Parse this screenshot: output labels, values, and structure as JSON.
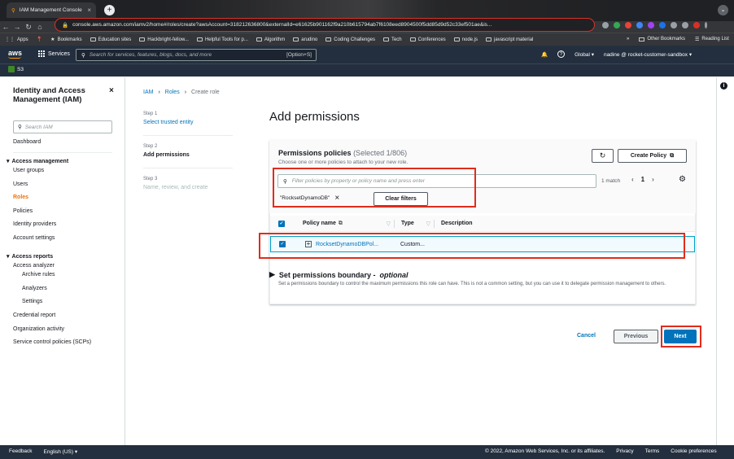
{
  "browser": {
    "tab_title": "IAM Management Console",
    "url": "console.aws.amazon.com/iamv2/home#/roles/create?awsAccount=318212636800&externalId=e61625b901162f9a210b615794ab7f6108eed8904500f5dd85d9d52c33ef501ae&is...",
    "bookmarks": [
      "Apps",
      "Bookmarks",
      "Education sites",
      "Hackbright-fellow...",
      "Helpful Tools for p...",
      "Algorithm",
      "arudino",
      "Coding Challenges",
      "Tech",
      "Conferences",
      "node.js",
      "javascript material"
    ],
    "other_bookmarks": "Other Bookmarks",
    "reading_list": "Reading List"
  },
  "aws_nav": {
    "logo": "aws",
    "services_label": "Services",
    "search_placeholder": "Search for services, features, blogs, docs, and more",
    "search_shortcut": "[Option+S]",
    "region": "Global ▾",
    "account": "nadine @ rocket-customer-sandbox ▾",
    "favorite": "S3"
  },
  "sidebar": {
    "title": "Identity and Access Management (IAM)",
    "search_placeholder": "Search IAM",
    "dashboard": "Dashboard",
    "access_management": "Access management",
    "am_items": [
      "User groups",
      "Users",
      "Roles",
      "Policies",
      "Identity providers",
      "Account settings"
    ],
    "access_reports": "Access reports",
    "ar_items": [
      "Access analyzer",
      "Archive rules",
      "Analyzers",
      "Settings",
      "Credential report",
      "Organization activity",
      "Service control policies (SCPs)"
    ]
  },
  "breadcrumb": [
    "IAM",
    "Roles",
    "Create role"
  ],
  "steps": [
    {
      "num": "Step 1",
      "label": "Select trusted entity"
    },
    {
      "num": "Step 2",
      "label": "Add permissions"
    },
    {
      "num": "Step 3",
      "label": "Name, review, and create"
    }
  ],
  "page_title": "Add permissions",
  "policies": {
    "title": "Permissions policies",
    "count": "(Selected 1/806)",
    "subtitle": "Choose one or more policies to attach to your new role.",
    "create_button": "Create Policy",
    "filter_placeholder": "Filter policies by property or policy name and press enter",
    "match": "1 match",
    "page": "1",
    "token": "\"RocksetDynamoDB\"",
    "clear_filters": "Clear filters",
    "columns": [
      "Policy name",
      "Type",
      "Description"
    ],
    "row": {
      "name": "RocksetDynamoDBPol...",
      "type": "Custom...",
      "description": ""
    }
  },
  "boundary": {
    "title": "Set permissions boundary -",
    "optional": "optional",
    "description": "Set a permissions boundary to control the maximum permissions this role can have. This is not a common setting, but you can use it to delegate permission management to others."
  },
  "actions": {
    "cancel": "Cancel",
    "previous": "Previous",
    "next": "Next"
  },
  "footer": {
    "feedback": "Feedback",
    "language": "English (US) ▾",
    "copyright": "© 2022, Amazon Web Services, Inc. or its affiliates.",
    "privacy": "Privacy",
    "terms": "Terms",
    "cookies": "Cookie preferences"
  },
  "colors": {
    "accent": "#0073bb",
    "primary_button": "#0073bb",
    "nav_bg": "#232f3e",
    "annotation": "#e12c1c",
    "active_nav": "#ec7211"
  }
}
